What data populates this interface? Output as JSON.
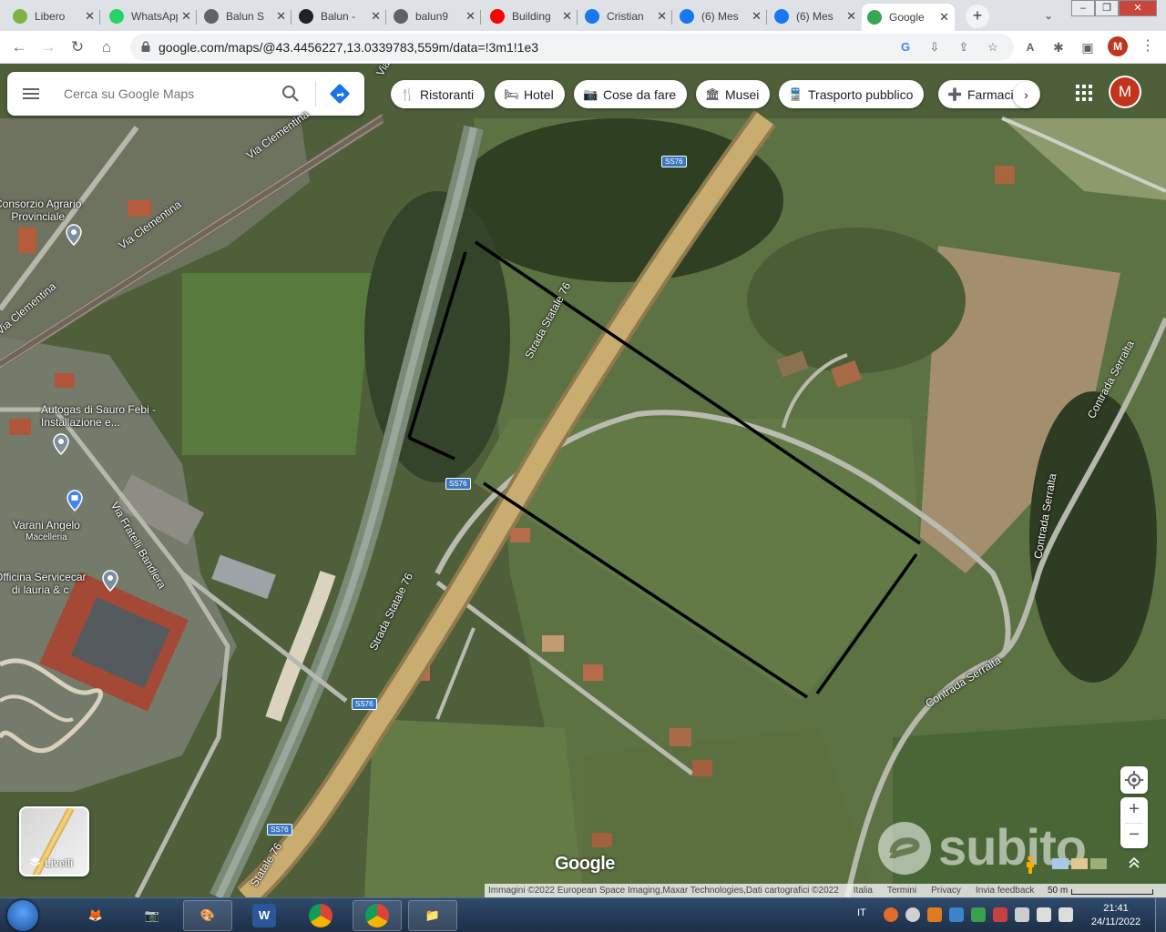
{
  "browser": {
    "tabs": [
      {
        "title": "Libero",
        "icon": "libero-swirl-icon",
        "color": "#7cb342"
      },
      {
        "title": "WhatsApp",
        "icon": "whatsapp-icon",
        "color": "#25d366"
      },
      {
        "title": "Balun S",
        "icon": "globe-icon",
        "color": "#5f6368"
      },
      {
        "title": "Balun -",
        "icon": "j-letter-icon",
        "color": "#202124"
      },
      {
        "title": "balun9",
        "icon": "globe-icon",
        "color": "#5f6368"
      },
      {
        "title": "Building",
        "icon": "youtube-icon",
        "color": "#ff0000"
      },
      {
        "title": "Cristian",
        "icon": "facebook-icon",
        "color": "#1877f2"
      },
      {
        "title": "(6) Mes",
        "icon": "facebook-icon",
        "color": "#1877f2"
      },
      {
        "title": "(6) Mes",
        "icon": "facebook-icon",
        "color": "#1877f2"
      },
      {
        "title": "Google",
        "icon": "google-maps-pin-icon",
        "color": "#34a853"
      }
    ],
    "active_tab": 9,
    "tab_close_glyph": "✕",
    "new_tab_glyph": "+",
    "url": "google.com/maps/@43.4456227,13.0339783,559m/data=!3m1!1e3",
    "profile_initial": "M"
  },
  "maps": {
    "search_placeholder": "Cerca su Google Maps",
    "chips": [
      {
        "label": "Ristoranti",
        "icon": "fork-knife-icon",
        "glyph": "🍴"
      },
      {
        "label": "Hotel",
        "icon": "bed-icon",
        "glyph": "🛏"
      },
      {
        "label": "Cose da fare",
        "icon": "camera-icon",
        "glyph": "📷"
      },
      {
        "label": "Musei",
        "icon": "museum-icon",
        "glyph": "🏛"
      },
      {
        "label": "Trasporto pubblico",
        "icon": "bus-icon",
        "glyph": "🚆"
      },
      {
        "label": "Farmacie",
        "icon": "pharmacy-icon",
        "glyph": "➕"
      }
    ],
    "avatar_initial": "M",
    "places": [
      {
        "name": "Consorzio Agrario",
        "name2": "Provinciale"
      },
      {
        "name": "Autogas di Sauro Febi -",
        "name2": "Installazione e..."
      },
      {
        "name": "Varani Angelo",
        "sub": "Macelleria"
      },
      {
        "name": "Officina Servicecar",
        "name2": "di lauria & c"
      }
    ],
    "roads": {
      "via_clementina": "Via Clementina",
      "strada_statale": "Strada Statale 76",
      "statale": "Statale 76",
      "via_fratelli": "Via Fratelli Bandiera",
      "contrada": "Contrada Serralta",
      "shield": "SS76",
      "via_top": "Via"
    },
    "layers_label": "Livelli",
    "google_logo": "Google",
    "attribution": {
      "imagery": "Immagini ©2022 European Space Imaging,Maxar Technologies,Dati cartografici ©2022",
      "links": [
        "Italia",
        "Termini",
        "Privacy",
        "Invia feedback"
      ],
      "scale": "50 m"
    },
    "watermark": "subito",
    "ctrl_zoom_in": "+",
    "ctrl_zoom_out": "−"
  },
  "taskbar": {
    "apps": [
      {
        "name": "firefox",
        "glyph": "🦊",
        "color": "#e66000"
      },
      {
        "name": "screenshot-tool",
        "glyph": "📷",
        "color": "#7a7a7a"
      },
      {
        "name": "paint",
        "glyph": "🎨",
        "color": "#c0392b"
      },
      {
        "name": "word",
        "glyph": "W",
        "color": "#2b579a"
      },
      {
        "name": "chrome",
        "glyph": "◉",
        "color": "#db4437"
      },
      {
        "name": "chrome-active",
        "glyph": "◉",
        "color": "#db4437"
      },
      {
        "name": "file-explorer",
        "glyph": "📁",
        "color": "#e6b33c"
      }
    ],
    "lang": "IT",
    "time": "21:41",
    "date": "24/11/2022"
  }
}
